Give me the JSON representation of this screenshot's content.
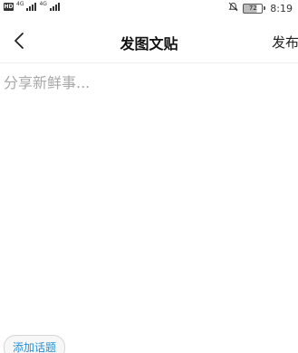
{
  "status_bar": {
    "hd_badge": "HD",
    "net_1": "4G",
    "net_2": "4G",
    "battery": "72",
    "time": "8:19",
    "icons": [
      "hd-icon",
      "signal-icon",
      "mute-icon",
      "battery-icon"
    ]
  },
  "header": {
    "title": "发图文贴",
    "publish_label": "发布",
    "back_icon": "chevron-left-icon"
  },
  "editor": {
    "placeholder": "分享新鲜事..."
  },
  "toolbar": {
    "add_topic_label": "添加话题"
  },
  "colors": {
    "topic_text": "#2a8fd1",
    "placeholder": "#a8a8a8"
  }
}
